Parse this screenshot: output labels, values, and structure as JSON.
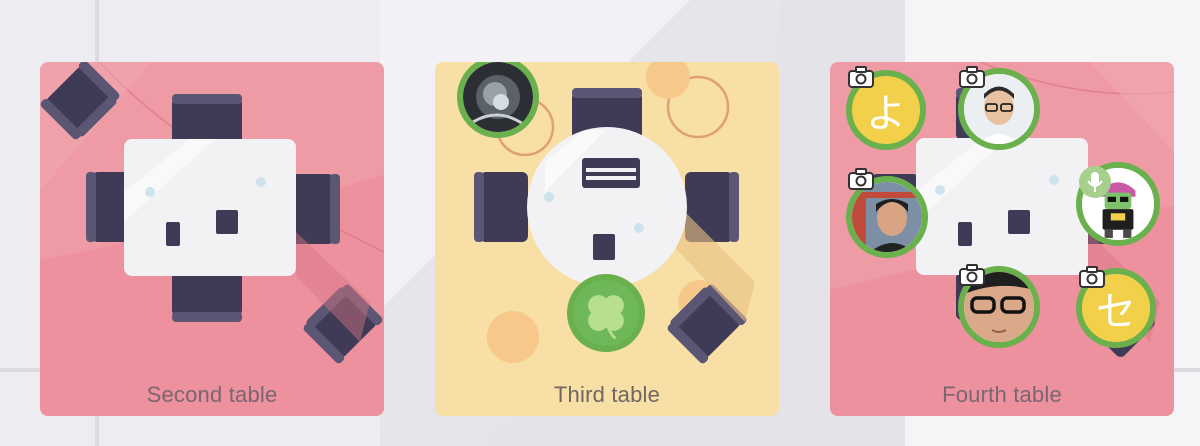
{
  "tables": [
    {
      "label": "Second table",
      "style": "square",
      "color": "#ef9ba5"
    },
    {
      "label": "Third table",
      "style": "round",
      "color": "#f8dfa6"
    },
    {
      "label": "Fourth table",
      "style": "square",
      "color": "#ef9ba5"
    }
  ],
  "third_table": {
    "participants": [
      {
        "avatar": "dark-photo-avatar",
        "muted_video": false
      },
      {
        "avatar": "four-leaf-clover-avatar",
        "muted_video": false
      }
    ]
  },
  "fourth_table": {
    "participants": [
      {
        "glyph": "よ",
        "camera_off": true
      },
      {
        "avatar": "man-with-glasses-photo",
        "camera_off": true
      },
      {
        "avatar": "person-red-gate-photo",
        "camera_off": true
      },
      {
        "avatar": "cartoon-character-avatar",
        "speaking": true
      },
      {
        "avatar": "closeup-glasses-photo",
        "camera_off": true
      },
      {
        "glyph": "セ",
        "camera_off": true
      }
    ]
  },
  "colors": {
    "active_ring": "#6ab04c",
    "chair": "#3f3a55",
    "table_top": "#f2f2f4"
  }
}
